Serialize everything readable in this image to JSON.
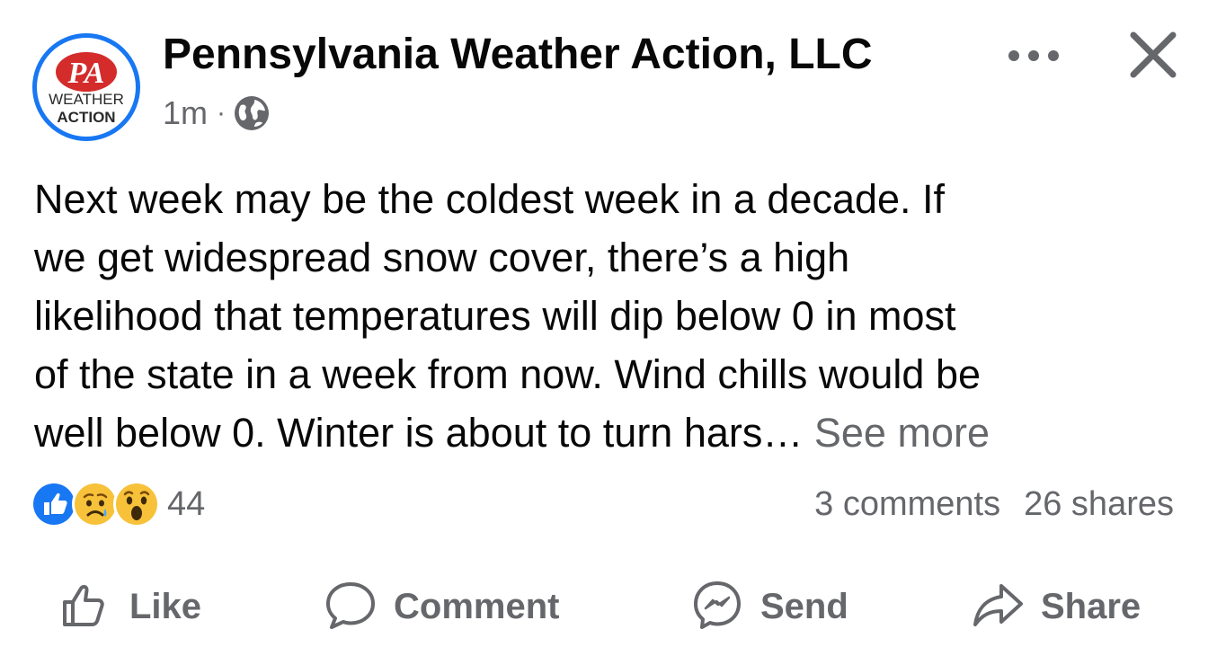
{
  "header": {
    "page_name": "Pennsylvania Weather Action, LLC",
    "time": "1m",
    "separator": "·",
    "avatar_logo_text": "PA WEATHER ACTION",
    "privacy_icon": "globe-icon",
    "more_icon": "more-horizontal-icon",
    "close_icon": "close-icon"
  },
  "post": {
    "text": "Next week may be the coldest week in a decade. If\nwe get widespread snow cover, there’s a high\nlikelihood that temperatures will dip below 0 in most\nof the state in a week from now. Wind chills would be\nwell below 0. Winter is about to turn hars…",
    "see_more": "See more"
  },
  "engagement": {
    "reaction_icons": [
      "like-reaction-icon",
      "sad-reaction-icon",
      "wow-reaction-icon"
    ],
    "reaction_count": "44",
    "comments": "3 comments",
    "shares": "26 shares"
  },
  "actions": [
    {
      "label": "Like",
      "icon": "thumbs-up-icon"
    },
    {
      "label": "Comment",
      "icon": "comment-bubble-icon"
    },
    {
      "label": "Send",
      "icon": "messenger-icon"
    },
    {
      "label": "Share",
      "icon": "share-arrow-icon"
    }
  ],
  "colors": {
    "brand_blue": "#1877f2",
    "logo_red": "#d42b2b",
    "secondary_text": "#65676b",
    "primary_text": "#080809",
    "reaction_yellow": "#f7c23a"
  }
}
